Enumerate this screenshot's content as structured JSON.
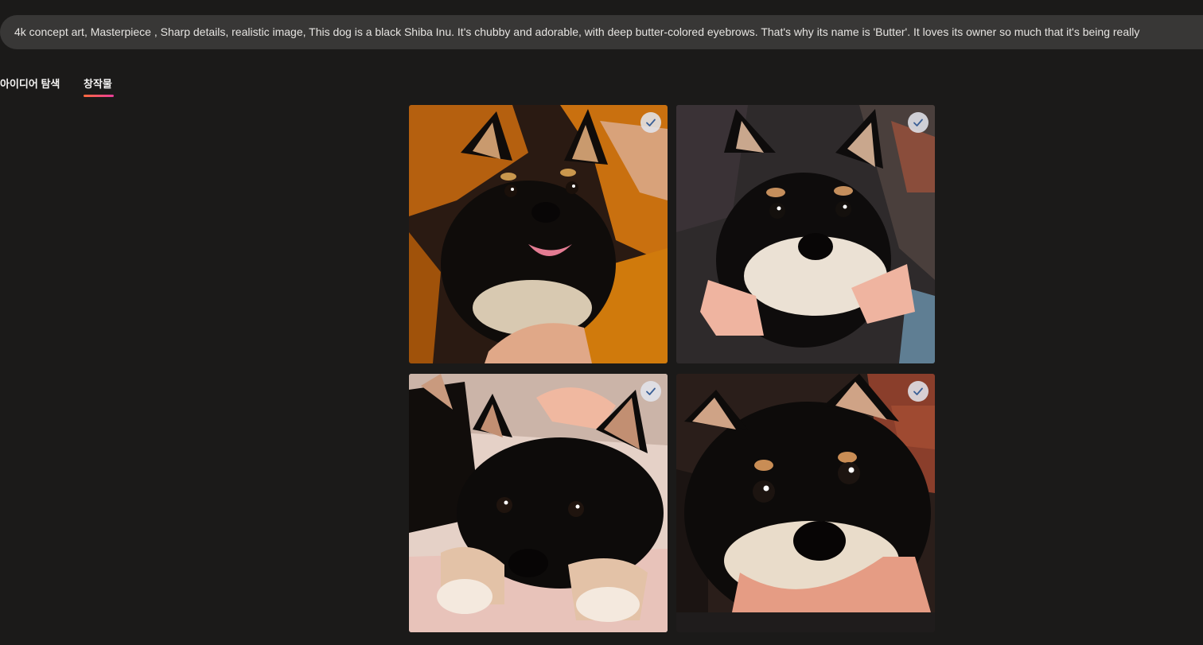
{
  "prompt": {
    "text": "4k concept art,  Masterpiece , Sharp details, realistic image, This dog is a black Shiba Inu. It's chubby and adorable, with deep butter-colored eyebrows. That's why its name is 'Butter'. It loves its owner so much that it's being really"
  },
  "tabs": [
    {
      "label": "아이디어 탐색",
      "active": false
    },
    {
      "label": "창작물",
      "active": true
    }
  ],
  "colors": {
    "background": "#1b1a19",
    "prompt_bar": "#383736",
    "accent_gradient_start": "#ff6a3d",
    "accent_gradient_end": "#e93d9a",
    "check_icon": "#3a5f96"
  },
  "images": [
    {
      "alt": "black Shiba Inu smiling, held by person in orange sweater",
      "selected": true
    },
    {
      "alt": "black Shiba Inu face held in owner's hands",
      "selected": true
    },
    {
      "alt": "black Shiba Inu lying on pink blanket",
      "selected": true
    },
    {
      "alt": "black Shiba Inu resting chin on owner's hand",
      "selected": true
    }
  ]
}
